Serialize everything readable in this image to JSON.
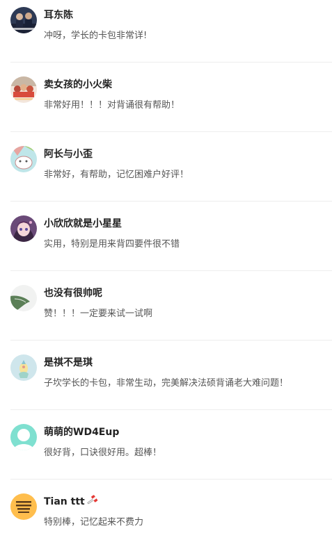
{
  "reviews": [
    {
      "name": "耳东陈",
      "comment": "冲呀，学长的卡包非常详!"
    },
    {
      "name": "卖女孩的小火柴",
      "comment": "非常好用！！！对背诵很有帮助！"
    },
    {
      "name": "阿长与小歪",
      "comment": "非常好，有帮助，记忆困难户好评！"
    },
    {
      "name": "小欣欣就是小星星",
      "comment": "实用，特别是用来背四要件很不错"
    },
    {
      "name": "也没有很帅呢",
      "comment": "赞！！！一定要来试一试啊"
    },
    {
      "name": "是祺不是琪",
      "comment": "子坎学长的卡包，非常生动，完美解决法硕背诵老大难问题！"
    },
    {
      "name": "萌萌的WD4Eup",
      "comment": "很好背，口诀很好用。超棒！"
    },
    {
      "name": "Tian ttt",
      "comment": "特别棒，记忆起来不费力"
    }
  ],
  "colors": {
    "name": "#222222",
    "comment": "#555555",
    "divider": "#ededed",
    "default_avatar": "#7fe0d0",
    "yellow_avatar": "#ffbe4d"
  }
}
